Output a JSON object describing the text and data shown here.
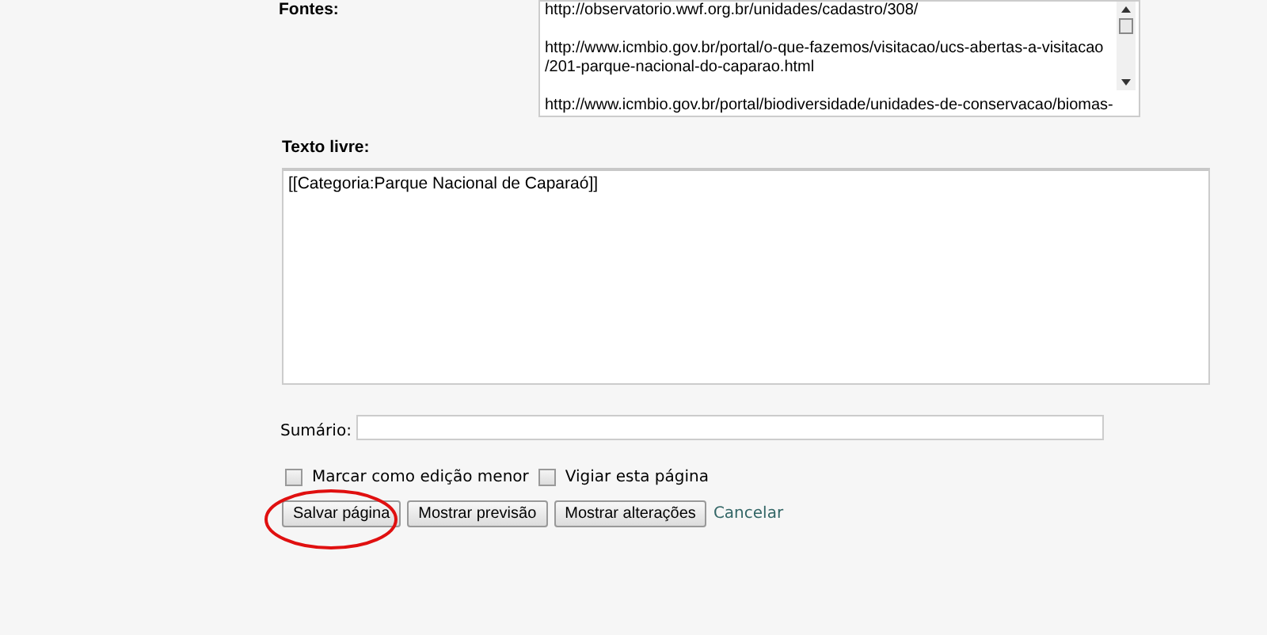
{
  "sources": {
    "label": "Fontes:",
    "value": "http://observatorio.wwf.org.br/unidades/cadastro/308/\n\nhttp://www.icmbio.gov.br/portal/o-que-fazemos/visitacao/ucs-abertas-a-visitacao\n/201-parque-nacional-do-caparao.html\n\nhttp://www.icmbio.gov.br/portal/biodiversidade/unidades-de-conservacao/biomas-"
  },
  "free_text": {
    "label": "Texto livre:",
    "value": "[[Categoria:Parque Nacional de Caparaó]]"
  },
  "summary": {
    "label": "Sumário:"
  },
  "options": [
    {
      "label": "Marcar como edição menor",
      "checked": false
    },
    {
      "label": "Vigiar esta página",
      "checked": false
    }
  ],
  "buttons": [
    {
      "label": "Salvar página",
      "kind": "button"
    },
    {
      "label": "Mostrar previsão",
      "kind": "button"
    },
    {
      "label": "Mostrar alterações",
      "kind": "button"
    },
    {
      "label": "Cancelar",
      "kind": "link"
    }
  ]
}
